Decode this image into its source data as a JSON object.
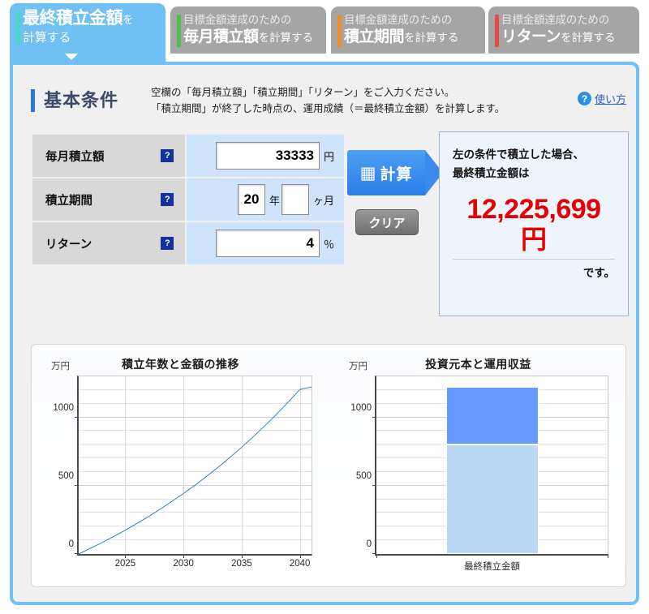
{
  "tabs": [
    {
      "id": "final-amount",
      "line1": "",
      "big": "最終積立金額",
      "small": "を",
      "line2b": "計算する",
      "active": true,
      "accent": "#4ad6c0"
    },
    {
      "id": "monthly-amount",
      "line1": "目標金額達成のための",
      "big": "毎月積立額",
      "small": "を計算する",
      "active": false,
      "accent": "#4cc24c"
    },
    {
      "id": "period",
      "line1": "目標金額達成のための",
      "big": "積立期間",
      "small": "を計算する",
      "active": false,
      "accent": "#f08c28"
    },
    {
      "id": "return",
      "line1": "目標金額達成のための",
      "big": "リターン",
      "small": "を計算する",
      "active": false,
      "accent": "#e84a4a"
    }
  ],
  "condition": {
    "title": "基本条件",
    "desc_line1": "空欄の「毎月積立額」「積立期間」「リターン」をご入力ください。",
    "desc_line2": "「積立期間」が終了した時点の、運用成績（＝最終積立金額）を計算します。",
    "help_icon": "question-mark",
    "help_text": "使い方",
    "help_mark": "?"
  },
  "inputs": {
    "help_mark": "?",
    "rows": [
      {
        "label": "毎月積立額",
        "value": "33333",
        "unit": "円",
        "value2": "",
        "unit2": ""
      },
      {
        "label": "積立期間",
        "value": "20",
        "unit": "年",
        "value2": "",
        "unit2": "ヶ月"
      },
      {
        "label": "リターン",
        "value": "4",
        "unit": "％",
        "value2": "",
        "unit2": ""
      }
    ]
  },
  "actions": {
    "calc_icon": "calculator-icon",
    "calc_glyph": "▦",
    "calc_label": "計算",
    "clear_label": "クリア"
  },
  "result": {
    "line1": "左の条件で積立した場合、",
    "line2": "最終積立金額は",
    "amount": "12,225,699",
    "yen": "円",
    "suffix": "です。",
    "color": "#e60000"
  },
  "chart_data": [
    {
      "type": "line",
      "title": "積立年数と金額の推移",
      "ylabel": "万円",
      "xlabel": "",
      "categories": [],
      "x": [
        2021,
        2022,
        2023,
        2024,
        2025,
        2026,
        2027,
        2028,
        2029,
        2030,
        2031,
        2032,
        2033,
        2034,
        2035,
        2036,
        2037,
        2038,
        2039,
        2040,
        2041
      ],
      "values": [
        0,
        41,
        83,
        128,
        174,
        223,
        274,
        328,
        384,
        443,
        504,
        569,
        636,
        707,
        781,
        858,
        939,
        1023,
        1112,
        1204,
        1222.6
      ],
      "xticks": [
        2025,
        2030,
        2035,
        2040
      ],
      "yticks": [
        0,
        500,
        1000
      ],
      "ylim": [
        0,
        1300
      ],
      "xlim": [
        2021,
        2041
      ],
      "grid": true,
      "legend": "none",
      "series_color": "#1f7cb4"
    },
    {
      "type": "bar",
      "title": "投資元本と運用収益",
      "ylabel": "万円",
      "xlabel": "",
      "categories": [
        "最終積立金額"
      ],
      "series": [
        {
          "name": "投資元本",
          "values": [
            800
          ],
          "color": "#bbd9f5"
        },
        {
          "name": "運用収益",
          "values": [
            422.6
          ],
          "color": "#6699ff"
        }
      ],
      "yticks": [
        0,
        500,
        1000
      ],
      "ylim": [
        0,
        1300
      ],
      "grid": true,
      "legend": "none",
      "stacked": true
    }
  ]
}
